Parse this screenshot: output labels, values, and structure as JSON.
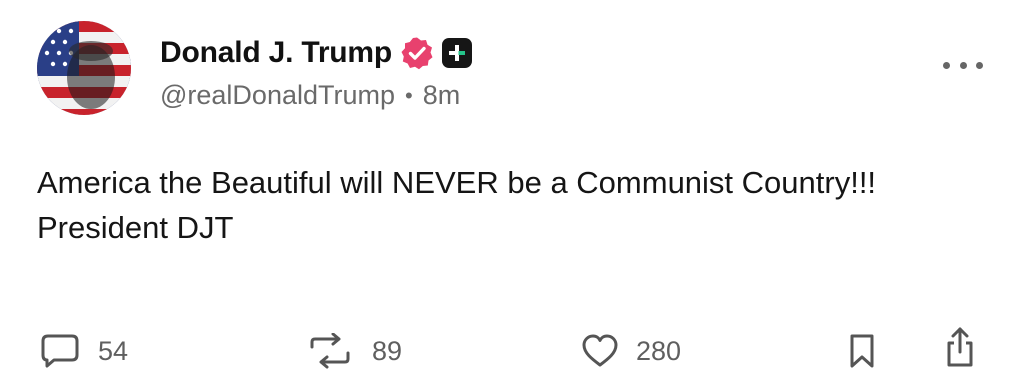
{
  "post": {
    "author": {
      "display_name": "Donald J. Trump",
      "handle": "@realDonaldTrump",
      "separator": "•",
      "timestamp": "8m",
      "verified_color": "#e8416e"
    },
    "text": "America the Beautiful will NEVER be a Communist Country!!! President DJT",
    "actions": {
      "replies": "54",
      "reposts": "89",
      "likes": "280"
    },
    "icons": {
      "reply": "speech-bubble-icon",
      "repost": "repost-arrows-icon",
      "like": "heart-icon",
      "bookmark": "bookmark-icon",
      "share": "share-upload-icon",
      "more": "more-dots-icon",
      "verified": "verified-badge-icon",
      "plus": "plus-badge-icon"
    }
  }
}
